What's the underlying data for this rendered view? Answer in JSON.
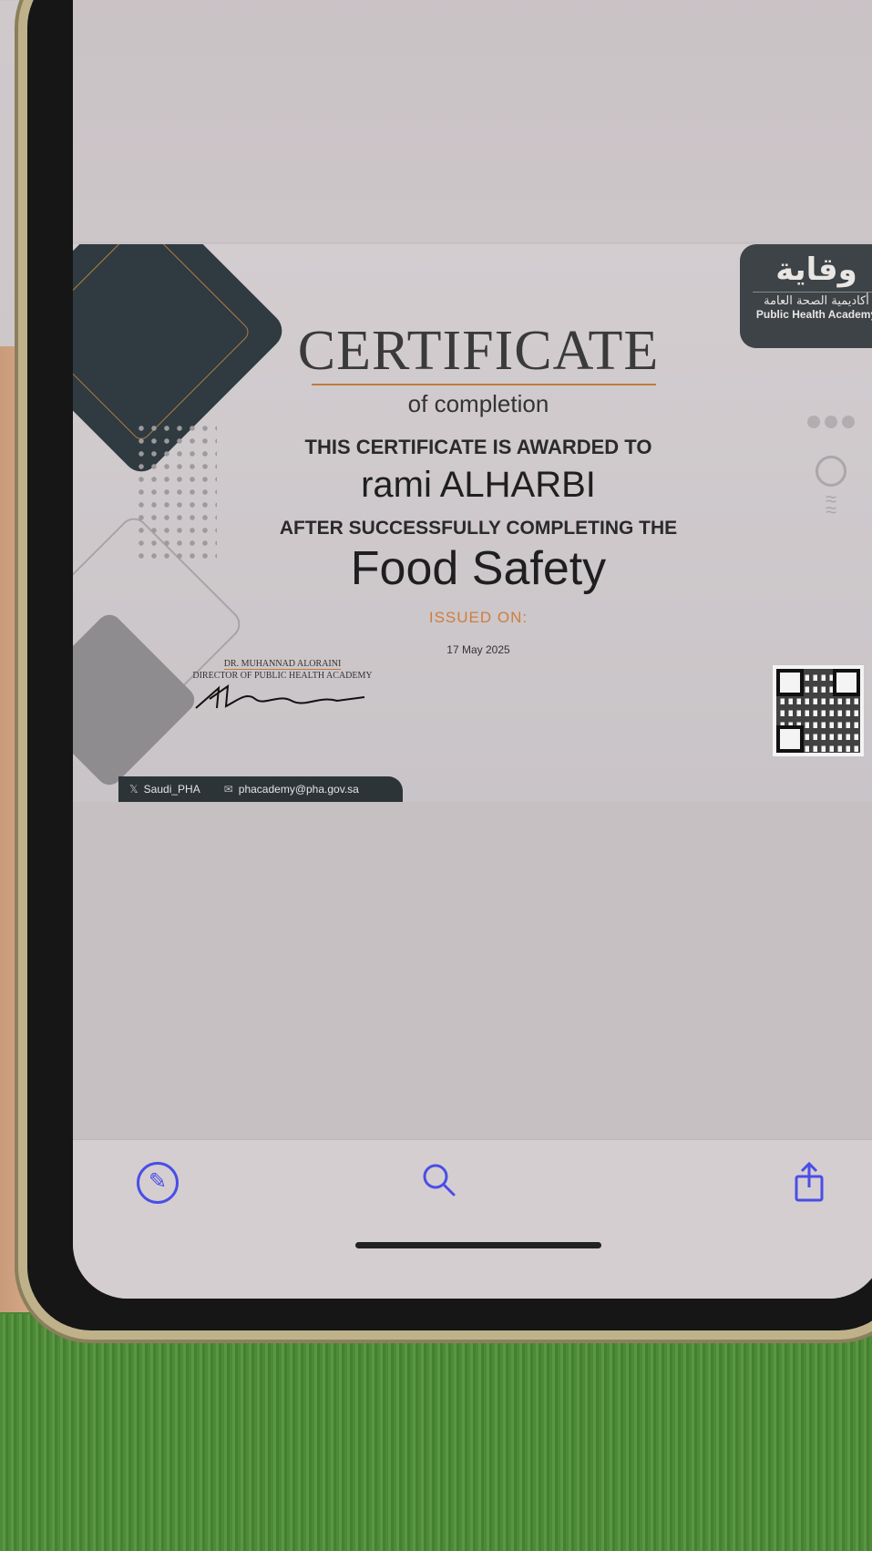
{
  "certificate": {
    "logo_arabic": "وقاية",
    "logo_arabic_sub": "أكاديمية الصحة العامة",
    "logo_english": "Public Health Academy",
    "title": "CERTIFICATE",
    "subtitle": "of completion",
    "awarded_text": "THIS CERTIFICATE IS AWARDED TO",
    "recipient_name": "rami ALHARBI",
    "after_text": "AFTER SUCCESSFULLY COMPLETING THE",
    "course_name": "Food Safety",
    "issued_label": "ISSUED ON:",
    "issued_date": "17 May 2025",
    "signatory_name": "DR. MUHANNAD ALORAINI",
    "signatory_title": "DIRECTOR OF PUBLIC HEALTH ACADEMY",
    "footer_twitter": "Saudi_PHA",
    "footer_email": "phacademy@pha.gov.sa"
  },
  "toolbar": {
    "markup_icon": "markup-icon",
    "search_icon": "search-icon",
    "share_icon": "share-icon"
  },
  "colors": {
    "accent_blue": "#4a4ee6",
    "orange": "#d07c3e",
    "dark_panel": "#2f3b40"
  }
}
